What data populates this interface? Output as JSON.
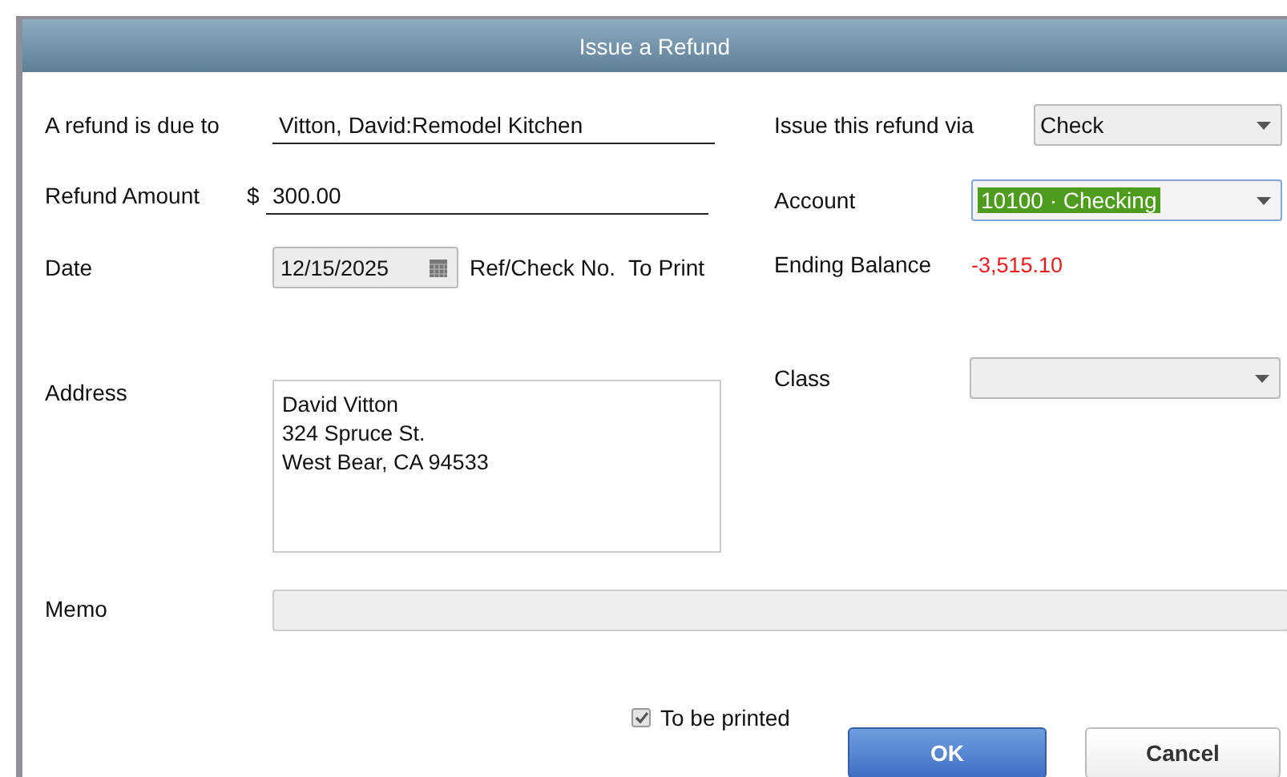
{
  "window": {
    "title": "Issue a Refund"
  },
  "customer": {
    "label": "A refund is due to",
    "value": "Vitton, David:Remodel Kitchen"
  },
  "amount": {
    "label": "Refund Amount",
    "currency": "$",
    "value": "300.00"
  },
  "date": {
    "label": "Date",
    "value": "12/15/2025"
  },
  "ref": {
    "label": "Ref/Check No.",
    "value": "To Print"
  },
  "address": {
    "label": "Address",
    "lines": [
      "David Vitton",
      "324 Spruce St.",
      "West Bear, CA 94533"
    ]
  },
  "memo": {
    "label": "Memo"
  },
  "refund_via": {
    "label": "Issue this refund via",
    "value": "Check"
  },
  "account": {
    "label": "Account",
    "value": "10100 · Checking",
    "selected": true
  },
  "ending_balance": {
    "label": "Ending Balance",
    "value": "-3,515.10"
  },
  "class": {
    "label": "Class"
  },
  "to_be_printed": {
    "label": "To be printed",
    "checked": true
  },
  "buttons": [
    {
      "label": "OK",
      "primary": true
    },
    {
      "label": "Cancel",
      "primary": false
    }
  ]
}
